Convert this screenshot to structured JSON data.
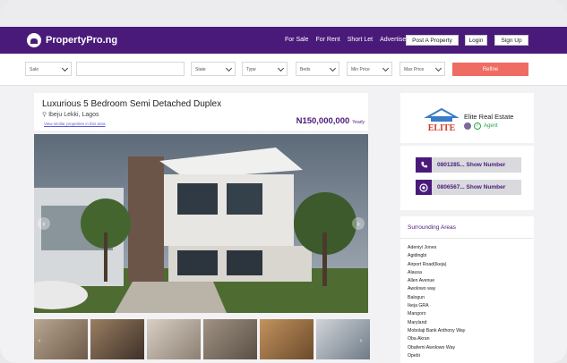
{
  "brand": {
    "name": "PropertyPro.ng"
  },
  "nav": {
    "links": [
      "For Sale",
      "For Rent",
      "Short Let",
      "Advertise"
    ],
    "post_button": "Post A Property",
    "login_button": "Login",
    "signup_button": "Sign Up"
  },
  "search": {
    "type_value": "Sale",
    "keyword_value": "",
    "state_value": "State",
    "property_type_value": "Type",
    "beds_value": "Beds",
    "min_price_value": "Min Price",
    "max_price_value": "Max Price",
    "refine_label": "Refine"
  },
  "listing": {
    "title": "Luxurious 5 Bedroom Semi Detached Duplex",
    "location": "Ibeju Lekki, Lagos",
    "similar_link": "View similar properties in this area",
    "price": "N150,000,000",
    "price_period": "Yearly"
  },
  "agent": {
    "name": "Elite Real Estate",
    "badge": "Agent",
    "logo_text": "ELITE"
  },
  "contact": {
    "phone_label": "0801285... Show Number",
    "whatsapp_label": "0806567... Show Number"
  },
  "surrounding": {
    "title": "Surrounding Areas",
    "areas": [
      "Adeniyi Jones",
      "Agidingbi",
      "Airport Road(Ikeja)",
      "Alausa",
      "Allen Avenue",
      "Awolowo way",
      "Balogun",
      "Ikeja GRA",
      "Mangoro",
      "Maryland",
      "Mobolaji Bank Anthony Way",
      "Oba Akran",
      "Obafemi Awolowo Way",
      "Opebi"
    ]
  },
  "colors": {
    "brand_purple": "#4a1a7a",
    "refine_red": "#ef6c62",
    "agent_green": "#2aa34a"
  }
}
